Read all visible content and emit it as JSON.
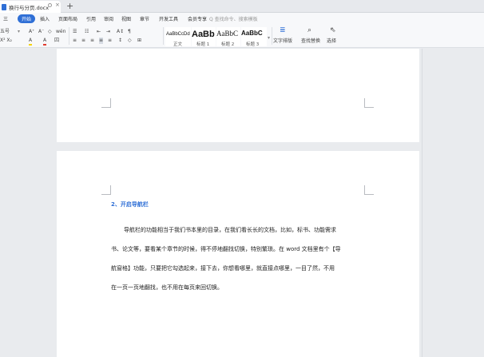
{
  "window": {
    "doc_tab_name": "换行与分页.docx",
    "new_tab_symbol": "+",
    "close_symbol": "×"
  },
  "menu": {
    "items": [
      "三",
      "开始",
      "插入",
      "页面布局",
      "引用",
      "审阅",
      "视图",
      "章节",
      "开发工具",
      "会员专享"
    ],
    "search_placeholder": "Q 查找命令、搜索模板"
  },
  "toolbar": {
    "font_size": "五号",
    "grow_font": "A⁺",
    "shrink_font": "A⁻",
    "clear_format": "◇",
    "pinyin": "wén",
    "bullets": "☰",
    "numbering": "☷",
    "indent_dec": "⇤",
    "indent_inc": "⇥",
    "sort": "A↕",
    "show_marks": "¶",
    "sub_sup": "X² X₂",
    "highlight": "A",
    "font_color": "A",
    "border_char": "囚",
    "align_left": "≡",
    "align_center": "≡",
    "align_right": "≡",
    "justify": "≡",
    "distribute": "≡",
    "line_spacing": "↕",
    "shading": "◇",
    "borders": "⊞",
    "styles": [
      {
        "sample": "AaBbCcDd",
        "name": "正文"
      },
      {
        "sample": "AaBb",
        "name": "标题 1"
      },
      {
        "sample": "AaBbC",
        "name": "标题 2"
      },
      {
        "sample": "AaBbC",
        "name": "标题 3"
      }
    ],
    "text_layout": "文字排版",
    "find_replace": "查找替换",
    "select": "选择"
  },
  "colors": {
    "accent": "#2f6fd6",
    "highlight_yellow": "#f5d300",
    "font_red": "#e03b2f"
  },
  "document": {
    "heading": "2、开启导航栏",
    "paragraph_lines": [
      "导航栏的功能相当于我们书本里的目录，在我们看长长的文档，比如，标书、功能需求",
      "书、论文等，要看某个章节的时候，得不停地翻找切换，特别繁琐。在 word 文档里有个【导",
      "航窗格】功能，只要把它勾选起来，接下去，你想看哪里，就直接点哪里，一目了然，不用",
      "在一页一页地翻找，也不用在每页来回切换。"
    ]
  }
}
